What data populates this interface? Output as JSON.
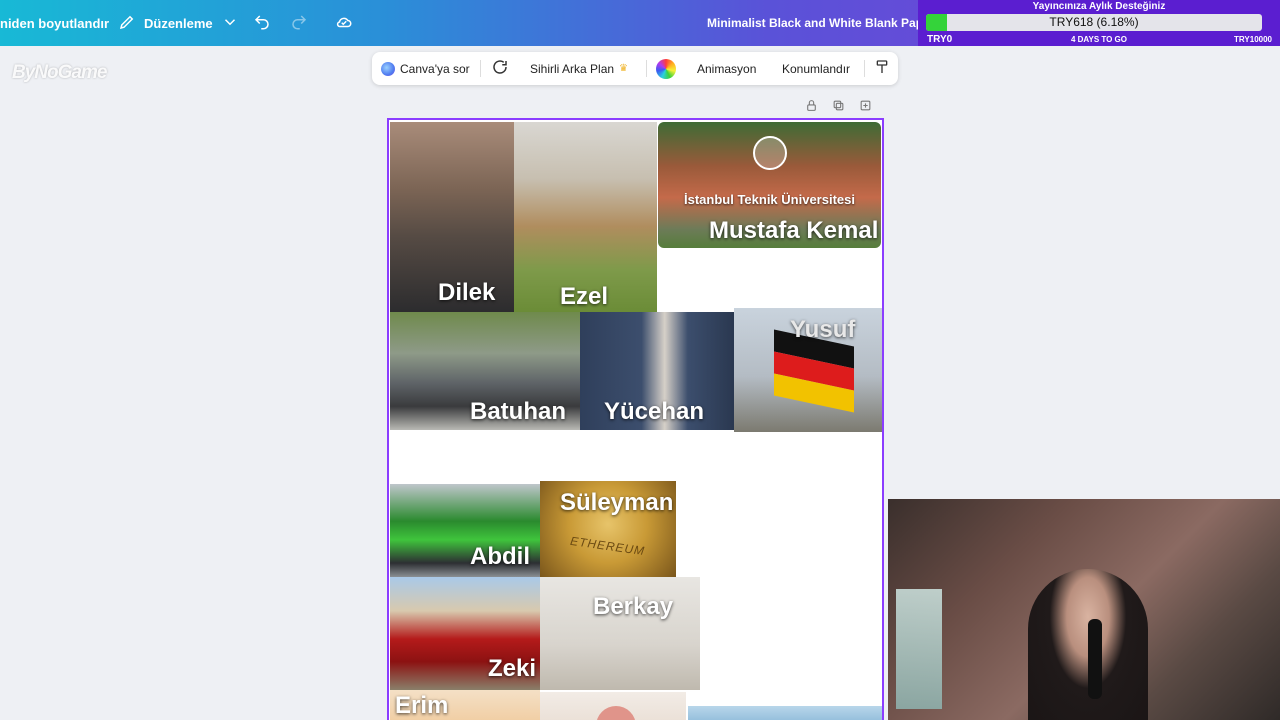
{
  "topbar": {
    "resize_label": "niden boyutlandır",
    "edit_label": "Düzenleme",
    "title": "Minimalist Black and White Blank Paper D"
  },
  "donation": {
    "title": "Yayıncınıza Aylık Desteğiniz",
    "amount": "TRY618 (6.18%)",
    "progress_fraction": 0.0618,
    "min_label": "TRY0",
    "days_left": "4 DAYS TO GO",
    "max_label": "TRY10000"
  },
  "watermark": "ByNoGame",
  "context_toolbar": {
    "ask": "Canva'ya sor",
    "magic_background": "Sihirli Arka Plan",
    "animation": "Animasyon",
    "position": "Konumlandır"
  },
  "tiles": {
    "dilek": "Dilek",
    "ezel": "Ezel",
    "mustafa": "Mustafa Kemal",
    "university": "İstanbul Teknik Üniversitesi",
    "batuhan": "Batuhan",
    "yucehan": "Yücehan",
    "yusuf": "Yusuf",
    "abdil": "Abdil",
    "suleyman": "Süleyman",
    "ethereum": "ETHEREUM",
    "zeki": "Zeki",
    "berkay": "Berkay",
    "erim": "Erim"
  },
  "colors": {
    "accent": "#8b3dff",
    "donation_bg": "#5b1ed0",
    "donation_fill": "#34d33a"
  }
}
